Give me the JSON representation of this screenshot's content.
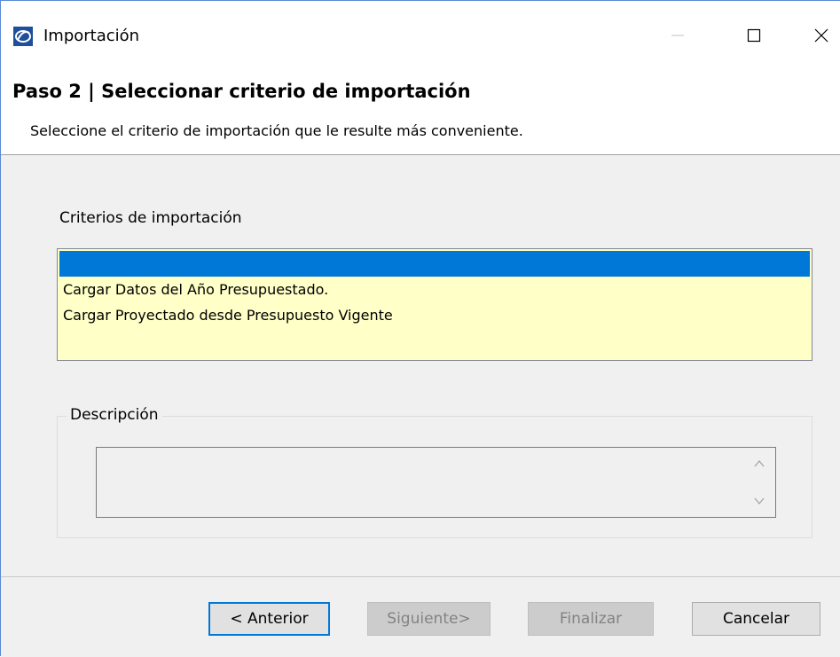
{
  "window": {
    "title": "Importación"
  },
  "header": {
    "step_title": "Paso 2 | Seleccionar criterio de importación",
    "subtitle": "Seleccione el criterio de importación que le resulte más conveniente."
  },
  "criteria": {
    "label": "Criterios de importación",
    "items": [
      {
        "label": "",
        "selected": true
      },
      {
        "label": "Cargar Datos del Año Presupuestado.",
        "selected": false
      },
      {
        "label": "Cargar Proyectado desde Presupuesto Vigente",
        "selected": false
      }
    ]
  },
  "description": {
    "legend": "Descripción",
    "value": ""
  },
  "buttons": {
    "previous": "< Anterior",
    "next": "Siguiente>",
    "finish": "Finalizar",
    "cancel": "Cancelar"
  },
  "colors": {
    "selection": "#0078d7",
    "list_background": "#ffffc8",
    "dialog_background": "#f0f0f0",
    "default_button_border": "#0078d7"
  },
  "icons": {
    "app": "app-logo-icon",
    "minimize": "minimize-icon",
    "maximize": "maximize-icon",
    "close": "close-icon"
  }
}
